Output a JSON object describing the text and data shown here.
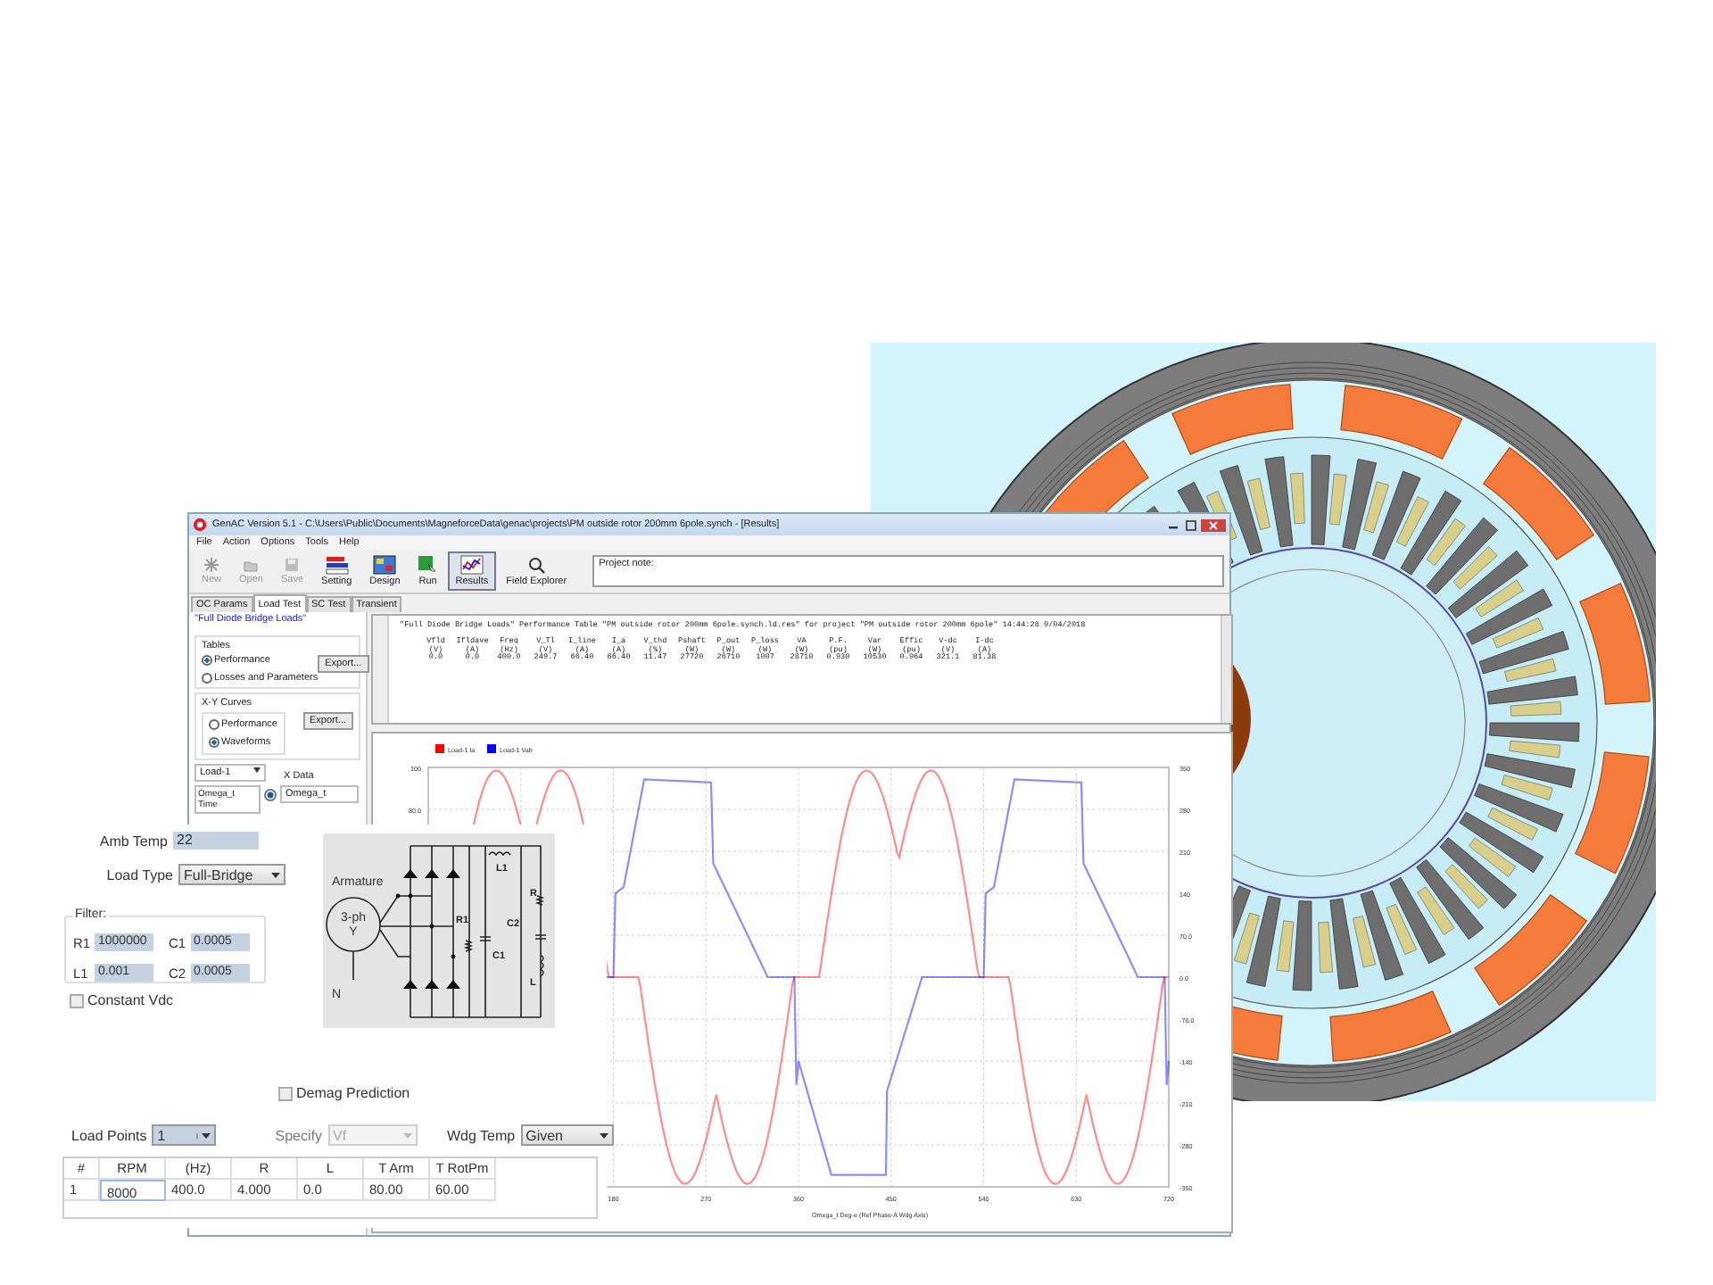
{
  "app_window": {
    "title": "GenAC Version 5.1 - C:\\Users\\Public\\Documents\\MagneforceData\\genac\\projects\\PM outside rotor 200mm 6pole.synch - [Results]",
    "menu": [
      "File",
      "Action",
      "Options",
      "Tools",
      "Help"
    ],
    "toolbar": [
      {
        "label": "New",
        "kind": "star",
        "disabled": true,
        "selected": false
      },
      {
        "label": "Open",
        "kind": "folder",
        "disabled": true,
        "selected": false
      },
      {
        "label": "Save",
        "kind": "disk",
        "disabled": true,
        "selected": false
      },
      {
        "label": "Setting",
        "kind": "stripes",
        "disabled": false,
        "selected": false
      },
      {
        "label": "Design",
        "kind": "grid",
        "disabled": false,
        "selected": false
      },
      {
        "label": "Run",
        "kind": "square",
        "disabled": false,
        "selected": false
      },
      {
        "label": "Results",
        "kind": "chart",
        "disabled": false,
        "selected": true
      },
      {
        "label": "Field Explorer",
        "kind": "search",
        "disabled": false,
        "selected": false
      }
    ],
    "project_note_label": "Project note:",
    "tabs": [
      {
        "label": "OC Params",
        "selected": false
      },
      {
        "label": "Load Test",
        "selected": true
      },
      {
        "label": "SC Test",
        "selected": false
      },
      {
        "label": "Transient",
        "selected": false
      }
    ],
    "left_panel": {
      "heading": "\"Full Diode Bridge Loads\"",
      "tables_group": {
        "title": "Tables",
        "options": [
          {
            "label": "Performance",
            "selected": true
          },
          {
            "label": "Losses and Parameters",
            "selected": false
          }
        ],
        "button": "Export..."
      },
      "curves_group": {
        "title": "X-Y Curves",
        "options": [
          {
            "label": "Performance",
            "selected": false
          },
          {
            "label": "Waveforms",
            "selected": true
          }
        ],
        "button": "Export..."
      },
      "load_select": "Load-1",
      "x_data_label": "X Data",
      "y_list": [
        "Omega_t",
        "Time"
      ],
      "x_data_selected": true,
      "x_data_value": "Omega_t"
    },
    "results": {
      "header": "\"Full Diode Bridge Loads\"  Performance Table \"PM outside rotor 200mm 6pole.synch.ld.res\" for project \"PM outside rotor 200mm 6pole\"  14:44:28   9/04/2018",
      "columns": [
        {
          "name": "Vfld",
          "unit": "(V)",
          "value": "0.0"
        },
        {
          "name": "Ifldave",
          "unit": "(A)",
          "value": "0.0"
        },
        {
          "name": "Freq",
          "unit": "(Hz)",
          "value": "400.0"
        },
        {
          "name": "V_Tl",
          "unit": "(V)",
          "value": "249.7"
        },
        {
          "name": "I_line",
          "unit": "(A)",
          "value": "66.40"
        },
        {
          "name": "I_a",
          "unit": "(A)",
          "value": "66.40"
        },
        {
          "name": "V_thd",
          "unit": "(%)",
          "value": "11.47"
        },
        {
          "name": "Pshaft",
          "unit": "(W)",
          "value": "27720"
        },
        {
          "name": "P_out",
          "unit": "(W)",
          "value": "26710"
        },
        {
          "name": "P_loss",
          "unit": "(W)",
          "value": "1007"
        },
        {
          "name": "VA",
          "unit": "(W)",
          "value": "28710"
        },
        {
          "name": "P.F.",
          "unit": "(pu)",
          "value": "0.930"
        },
        {
          "name": "Var",
          "unit": "(W)",
          "value": "10530"
        },
        {
          "name": "Effic",
          "unit": "(pu)",
          "value": "0.964"
        },
        {
          "name": "V-dc",
          "unit": "(V)",
          "value": "321.1"
        },
        {
          "name": "I-dc",
          "unit": "(A)",
          "value": "81.38"
        }
      ]
    },
    "chart": {
      "legend": [
        {
          "label": "Load-1 Ia",
          "color": "#ff0000"
        },
        {
          "label": "Load-1 Vab",
          "color": "#0000ff"
        }
      ],
      "left_ticks": [
        "100",
        "80.0"
      ],
      "right_ticks": [
        "350",
        "280",
        "210",
        "140",
        "70.0",
        "0.0",
        "-70.0",
        "-140",
        "-210",
        "-280",
        "-350"
      ],
      "x_ticks": [
        "180",
        "270",
        "360",
        "450",
        "540",
        "630",
        "720"
      ],
      "xlabel": "Omega_t Deg-e   (Ref Phase-A Wdg Axis)"
    }
  },
  "load_panel": {
    "amb_temp": {
      "label": "Amb Temp",
      "value": "22"
    },
    "load_type": {
      "label": "Load Type",
      "value": "Full-Bridge"
    },
    "filter": {
      "title": "Filter:",
      "fields": [
        {
          "label": "R1",
          "value": "1000000"
        },
        {
          "label": "C1",
          "value": "0.0005"
        },
        {
          "label": "L1",
          "value": "0.001"
        },
        {
          "label": "C2",
          "value": "0.0005"
        }
      ]
    },
    "constant_vdc": {
      "label": "Constant Vdc",
      "checked": false
    },
    "circuit": {
      "armature": "Armature",
      "source": "3-ph",
      "connection": "Y",
      "neutral": "N",
      "r1": "R1",
      "c1": "C1",
      "l1": "L1",
      "c2": "C2",
      "r": "R",
      "l": "L"
    },
    "demag": {
      "label": "Demag Prediction",
      "checked": false
    },
    "load_points": {
      "label": "Load Points",
      "value": "1"
    },
    "specify": {
      "label": "Specify",
      "value": "Vf",
      "disabled": true
    },
    "wdg_temp": {
      "label": "Wdg Temp",
      "value": "Given"
    },
    "grid": {
      "columns": [
        "#",
        "RPM",
        "(Hz)",
        "R",
        "L",
        "T Arm",
        "T RotPm"
      ],
      "rows": [
        [
          "1",
          "8000",
          "400.0",
          "4.000",
          "0.0",
          "80.00",
          "60.00"
        ]
      ]
    }
  }
}
